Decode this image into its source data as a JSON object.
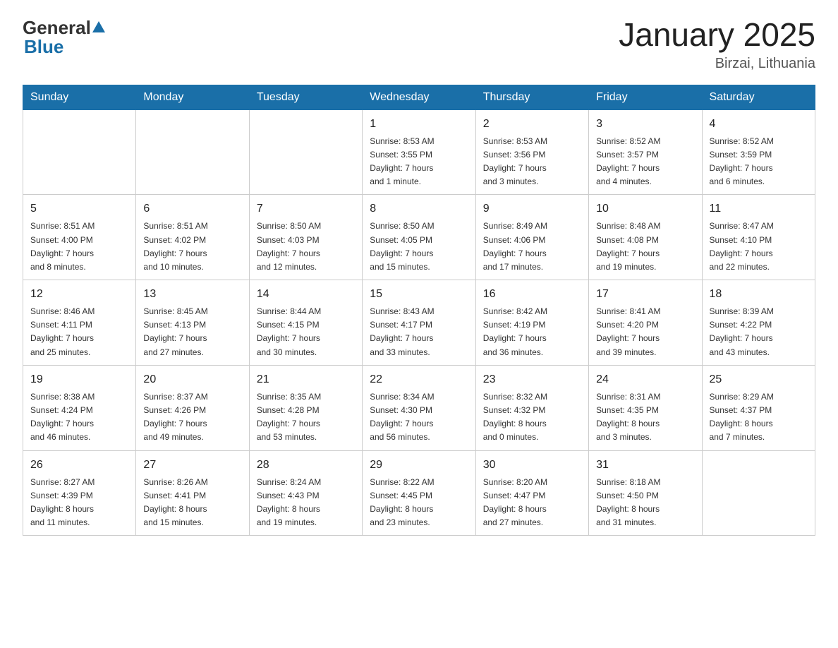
{
  "header": {
    "logo_general": "General",
    "logo_blue": "Blue",
    "title": "January 2025",
    "location": "Birzai, Lithuania"
  },
  "columns": [
    "Sunday",
    "Monday",
    "Tuesday",
    "Wednesday",
    "Thursday",
    "Friday",
    "Saturday"
  ],
  "weeks": [
    [
      {
        "day": "",
        "info": ""
      },
      {
        "day": "",
        "info": ""
      },
      {
        "day": "",
        "info": ""
      },
      {
        "day": "1",
        "info": "Sunrise: 8:53 AM\nSunset: 3:55 PM\nDaylight: 7 hours\nand 1 minute."
      },
      {
        "day": "2",
        "info": "Sunrise: 8:53 AM\nSunset: 3:56 PM\nDaylight: 7 hours\nand 3 minutes."
      },
      {
        "day": "3",
        "info": "Sunrise: 8:52 AM\nSunset: 3:57 PM\nDaylight: 7 hours\nand 4 minutes."
      },
      {
        "day": "4",
        "info": "Sunrise: 8:52 AM\nSunset: 3:59 PM\nDaylight: 7 hours\nand 6 minutes."
      }
    ],
    [
      {
        "day": "5",
        "info": "Sunrise: 8:51 AM\nSunset: 4:00 PM\nDaylight: 7 hours\nand 8 minutes."
      },
      {
        "day": "6",
        "info": "Sunrise: 8:51 AM\nSunset: 4:02 PM\nDaylight: 7 hours\nand 10 minutes."
      },
      {
        "day": "7",
        "info": "Sunrise: 8:50 AM\nSunset: 4:03 PM\nDaylight: 7 hours\nand 12 minutes."
      },
      {
        "day": "8",
        "info": "Sunrise: 8:50 AM\nSunset: 4:05 PM\nDaylight: 7 hours\nand 15 minutes."
      },
      {
        "day": "9",
        "info": "Sunrise: 8:49 AM\nSunset: 4:06 PM\nDaylight: 7 hours\nand 17 minutes."
      },
      {
        "day": "10",
        "info": "Sunrise: 8:48 AM\nSunset: 4:08 PM\nDaylight: 7 hours\nand 19 minutes."
      },
      {
        "day": "11",
        "info": "Sunrise: 8:47 AM\nSunset: 4:10 PM\nDaylight: 7 hours\nand 22 minutes."
      }
    ],
    [
      {
        "day": "12",
        "info": "Sunrise: 8:46 AM\nSunset: 4:11 PM\nDaylight: 7 hours\nand 25 minutes."
      },
      {
        "day": "13",
        "info": "Sunrise: 8:45 AM\nSunset: 4:13 PM\nDaylight: 7 hours\nand 27 minutes."
      },
      {
        "day": "14",
        "info": "Sunrise: 8:44 AM\nSunset: 4:15 PM\nDaylight: 7 hours\nand 30 minutes."
      },
      {
        "day": "15",
        "info": "Sunrise: 8:43 AM\nSunset: 4:17 PM\nDaylight: 7 hours\nand 33 minutes."
      },
      {
        "day": "16",
        "info": "Sunrise: 8:42 AM\nSunset: 4:19 PM\nDaylight: 7 hours\nand 36 minutes."
      },
      {
        "day": "17",
        "info": "Sunrise: 8:41 AM\nSunset: 4:20 PM\nDaylight: 7 hours\nand 39 minutes."
      },
      {
        "day": "18",
        "info": "Sunrise: 8:39 AM\nSunset: 4:22 PM\nDaylight: 7 hours\nand 43 minutes."
      }
    ],
    [
      {
        "day": "19",
        "info": "Sunrise: 8:38 AM\nSunset: 4:24 PM\nDaylight: 7 hours\nand 46 minutes."
      },
      {
        "day": "20",
        "info": "Sunrise: 8:37 AM\nSunset: 4:26 PM\nDaylight: 7 hours\nand 49 minutes."
      },
      {
        "day": "21",
        "info": "Sunrise: 8:35 AM\nSunset: 4:28 PM\nDaylight: 7 hours\nand 53 minutes."
      },
      {
        "day": "22",
        "info": "Sunrise: 8:34 AM\nSunset: 4:30 PM\nDaylight: 7 hours\nand 56 minutes."
      },
      {
        "day": "23",
        "info": "Sunrise: 8:32 AM\nSunset: 4:32 PM\nDaylight: 8 hours\nand 0 minutes."
      },
      {
        "day": "24",
        "info": "Sunrise: 8:31 AM\nSunset: 4:35 PM\nDaylight: 8 hours\nand 3 minutes."
      },
      {
        "day": "25",
        "info": "Sunrise: 8:29 AM\nSunset: 4:37 PM\nDaylight: 8 hours\nand 7 minutes."
      }
    ],
    [
      {
        "day": "26",
        "info": "Sunrise: 8:27 AM\nSunset: 4:39 PM\nDaylight: 8 hours\nand 11 minutes."
      },
      {
        "day": "27",
        "info": "Sunrise: 8:26 AM\nSunset: 4:41 PM\nDaylight: 8 hours\nand 15 minutes."
      },
      {
        "day": "28",
        "info": "Sunrise: 8:24 AM\nSunset: 4:43 PM\nDaylight: 8 hours\nand 19 minutes."
      },
      {
        "day": "29",
        "info": "Sunrise: 8:22 AM\nSunset: 4:45 PM\nDaylight: 8 hours\nand 23 minutes."
      },
      {
        "day": "30",
        "info": "Sunrise: 8:20 AM\nSunset: 4:47 PM\nDaylight: 8 hours\nand 27 minutes."
      },
      {
        "day": "31",
        "info": "Sunrise: 8:18 AM\nSunset: 4:50 PM\nDaylight: 8 hours\nand 31 minutes."
      },
      {
        "day": "",
        "info": ""
      }
    ]
  ]
}
